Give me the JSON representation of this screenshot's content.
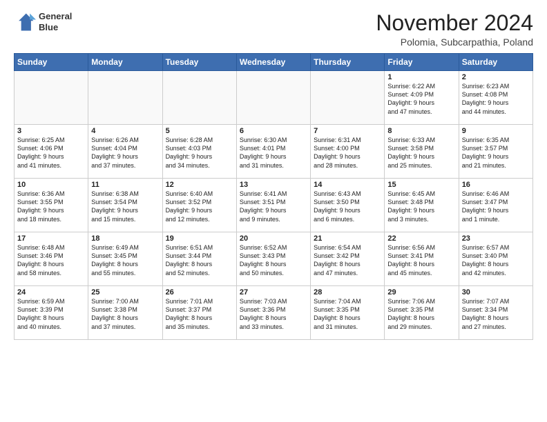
{
  "header": {
    "logo_line1": "General",
    "logo_line2": "Blue",
    "month": "November 2024",
    "location": "Polomia, Subcarpathia, Poland"
  },
  "weekdays": [
    "Sunday",
    "Monday",
    "Tuesday",
    "Wednesday",
    "Thursday",
    "Friday",
    "Saturday"
  ],
  "weeks": [
    [
      {
        "day": "",
        "info": ""
      },
      {
        "day": "",
        "info": ""
      },
      {
        "day": "",
        "info": ""
      },
      {
        "day": "",
        "info": ""
      },
      {
        "day": "",
        "info": ""
      },
      {
        "day": "1",
        "info": "Sunrise: 6:22 AM\nSunset: 4:09 PM\nDaylight: 9 hours\nand 47 minutes."
      },
      {
        "day": "2",
        "info": "Sunrise: 6:23 AM\nSunset: 4:08 PM\nDaylight: 9 hours\nand 44 minutes."
      }
    ],
    [
      {
        "day": "3",
        "info": "Sunrise: 6:25 AM\nSunset: 4:06 PM\nDaylight: 9 hours\nand 41 minutes."
      },
      {
        "day": "4",
        "info": "Sunrise: 6:26 AM\nSunset: 4:04 PM\nDaylight: 9 hours\nand 37 minutes."
      },
      {
        "day": "5",
        "info": "Sunrise: 6:28 AM\nSunset: 4:03 PM\nDaylight: 9 hours\nand 34 minutes."
      },
      {
        "day": "6",
        "info": "Sunrise: 6:30 AM\nSunset: 4:01 PM\nDaylight: 9 hours\nand 31 minutes."
      },
      {
        "day": "7",
        "info": "Sunrise: 6:31 AM\nSunset: 4:00 PM\nDaylight: 9 hours\nand 28 minutes."
      },
      {
        "day": "8",
        "info": "Sunrise: 6:33 AM\nSunset: 3:58 PM\nDaylight: 9 hours\nand 25 minutes."
      },
      {
        "day": "9",
        "info": "Sunrise: 6:35 AM\nSunset: 3:57 PM\nDaylight: 9 hours\nand 21 minutes."
      }
    ],
    [
      {
        "day": "10",
        "info": "Sunrise: 6:36 AM\nSunset: 3:55 PM\nDaylight: 9 hours\nand 18 minutes."
      },
      {
        "day": "11",
        "info": "Sunrise: 6:38 AM\nSunset: 3:54 PM\nDaylight: 9 hours\nand 15 minutes."
      },
      {
        "day": "12",
        "info": "Sunrise: 6:40 AM\nSunset: 3:52 PM\nDaylight: 9 hours\nand 12 minutes."
      },
      {
        "day": "13",
        "info": "Sunrise: 6:41 AM\nSunset: 3:51 PM\nDaylight: 9 hours\nand 9 minutes."
      },
      {
        "day": "14",
        "info": "Sunrise: 6:43 AM\nSunset: 3:50 PM\nDaylight: 9 hours\nand 6 minutes."
      },
      {
        "day": "15",
        "info": "Sunrise: 6:45 AM\nSunset: 3:48 PM\nDaylight: 9 hours\nand 3 minutes."
      },
      {
        "day": "16",
        "info": "Sunrise: 6:46 AM\nSunset: 3:47 PM\nDaylight: 9 hours\nand 1 minute."
      }
    ],
    [
      {
        "day": "17",
        "info": "Sunrise: 6:48 AM\nSunset: 3:46 PM\nDaylight: 8 hours\nand 58 minutes."
      },
      {
        "day": "18",
        "info": "Sunrise: 6:49 AM\nSunset: 3:45 PM\nDaylight: 8 hours\nand 55 minutes."
      },
      {
        "day": "19",
        "info": "Sunrise: 6:51 AM\nSunset: 3:44 PM\nDaylight: 8 hours\nand 52 minutes."
      },
      {
        "day": "20",
        "info": "Sunrise: 6:52 AM\nSunset: 3:43 PM\nDaylight: 8 hours\nand 50 minutes."
      },
      {
        "day": "21",
        "info": "Sunrise: 6:54 AM\nSunset: 3:42 PM\nDaylight: 8 hours\nand 47 minutes."
      },
      {
        "day": "22",
        "info": "Sunrise: 6:56 AM\nSunset: 3:41 PM\nDaylight: 8 hours\nand 45 minutes."
      },
      {
        "day": "23",
        "info": "Sunrise: 6:57 AM\nSunset: 3:40 PM\nDaylight: 8 hours\nand 42 minutes."
      }
    ],
    [
      {
        "day": "24",
        "info": "Sunrise: 6:59 AM\nSunset: 3:39 PM\nDaylight: 8 hours\nand 40 minutes."
      },
      {
        "day": "25",
        "info": "Sunrise: 7:00 AM\nSunset: 3:38 PM\nDaylight: 8 hours\nand 37 minutes."
      },
      {
        "day": "26",
        "info": "Sunrise: 7:01 AM\nSunset: 3:37 PM\nDaylight: 8 hours\nand 35 minutes."
      },
      {
        "day": "27",
        "info": "Sunrise: 7:03 AM\nSunset: 3:36 PM\nDaylight: 8 hours\nand 33 minutes."
      },
      {
        "day": "28",
        "info": "Sunrise: 7:04 AM\nSunset: 3:35 PM\nDaylight: 8 hours\nand 31 minutes."
      },
      {
        "day": "29",
        "info": "Sunrise: 7:06 AM\nSunset: 3:35 PM\nDaylight: 8 hours\nand 29 minutes."
      },
      {
        "day": "30",
        "info": "Sunrise: 7:07 AM\nSunset: 3:34 PM\nDaylight: 8 hours\nand 27 minutes."
      }
    ]
  ]
}
